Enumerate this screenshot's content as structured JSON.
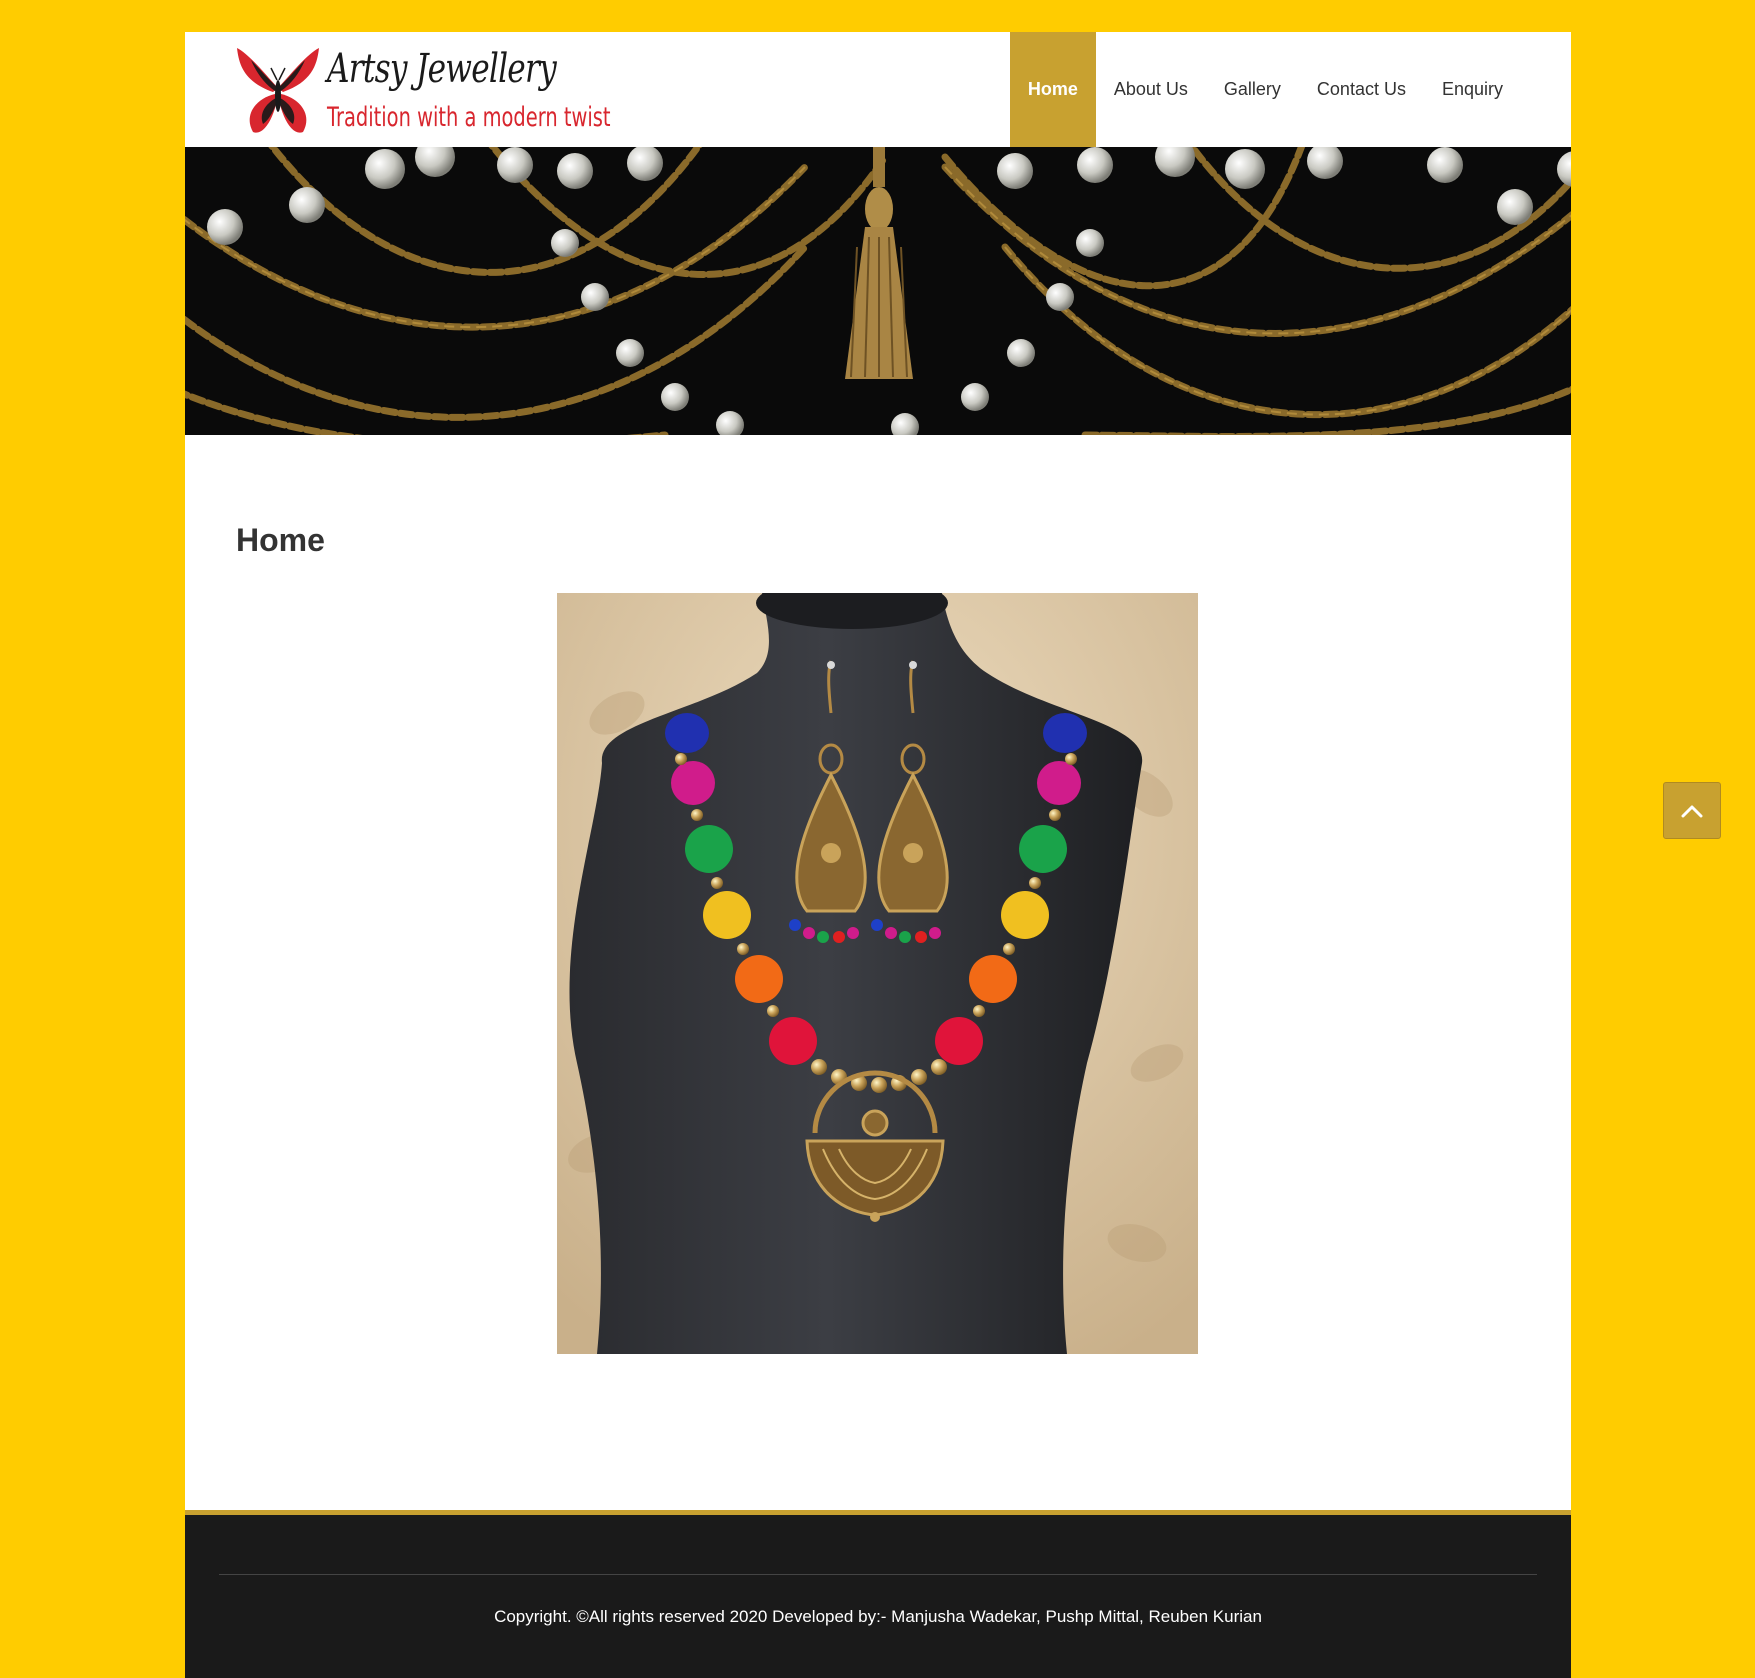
{
  "brand": {
    "name": "Artsy Jewellery",
    "tagline": "Tradition with a modern twist"
  },
  "nav": {
    "items": [
      {
        "label": "Home",
        "active": true
      },
      {
        "label": "About Us",
        "active": false
      },
      {
        "label": "Gallery",
        "active": false
      },
      {
        "label": "Contact Us",
        "active": false
      },
      {
        "label": "Enquiry",
        "active": false
      }
    ]
  },
  "main": {
    "title": "Home"
  },
  "footer": {
    "copyright": "Copyright. ©All rights reserved 2020 Developed by:- Manjusha Wadekar, Pushp Mittal, Reuben Kurian"
  },
  "colors": {
    "page_background": "#ffcc00",
    "accent_gold": "#c8a130",
    "footer_background": "#1a1a1a",
    "logo_red": "#d8262e"
  },
  "icons": {
    "back_to_top": "chevron-up-icon",
    "logo": "butterfly-icon"
  }
}
